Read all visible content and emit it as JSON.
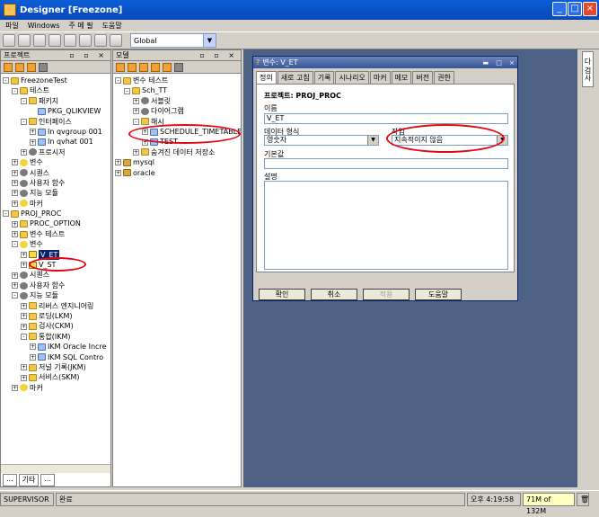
{
  "window": {
    "title": "Designer [Freezone]"
  },
  "menu": [
    "파일",
    "Windows",
    "주 메 필",
    "도움말"
  ],
  "toolbar": {
    "context_label": "Global"
  },
  "project_panel": {
    "title": "프로젝트",
    "tree": [
      {
        "d": 0,
        "label": "FreezoneTest",
        "icon": "folder",
        "exp": "-"
      },
      {
        "d": 1,
        "label": "테스트",
        "icon": "folder",
        "exp": "-"
      },
      {
        "d": 2,
        "label": "패키지",
        "icon": "folder",
        "exp": "-"
      },
      {
        "d": 3,
        "label": "PKG_QLIKVIEW",
        "icon": "doc",
        "exp": ""
      },
      {
        "d": 2,
        "label": "인터페이스",
        "icon": "folder",
        "exp": "-"
      },
      {
        "d": 3,
        "label": "In qvgroup 001",
        "icon": "doc",
        "exp": "+"
      },
      {
        "d": 3,
        "label": "In qvhat 001",
        "icon": "doc",
        "exp": "+"
      },
      {
        "d": 2,
        "label": "프로시저",
        "icon": "gear",
        "exp": "+"
      },
      {
        "d": 1,
        "label": "변수",
        "icon": "key",
        "exp": "+"
      },
      {
        "d": 1,
        "label": "시퀀스",
        "icon": "gear",
        "exp": "+"
      },
      {
        "d": 1,
        "label": "사용자 함수",
        "icon": "gear",
        "exp": "+"
      },
      {
        "d": 1,
        "label": "지능 모듈",
        "icon": "gear",
        "exp": "+"
      },
      {
        "d": 1,
        "label": "마커",
        "icon": "key",
        "exp": "+"
      },
      {
        "d": 0,
        "label": "PROJ_PROC",
        "icon": "folder",
        "exp": "-"
      },
      {
        "d": 1,
        "label": "PROC_OPTION",
        "icon": "folder",
        "exp": "+"
      },
      {
        "d": 1,
        "label": "변수 테스트",
        "icon": "folder",
        "exp": "+"
      },
      {
        "d": 1,
        "label": "변수",
        "icon": "key",
        "exp": "-"
      },
      {
        "d": 2,
        "label": "V_ET",
        "icon": "var",
        "exp": "+",
        "selected": true
      },
      {
        "d": 2,
        "label": "V_ST",
        "icon": "var",
        "exp": "+"
      },
      {
        "d": 1,
        "label": "시퀀스",
        "icon": "gear",
        "exp": "+"
      },
      {
        "d": 1,
        "label": "사용자 함수",
        "icon": "gear",
        "exp": "+"
      },
      {
        "d": 1,
        "label": "지능 모듈",
        "icon": "gear",
        "exp": "-"
      },
      {
        "d": 2,
        "label": "리버스 엔지니어링",
        "icon": "folder",
        "exp": "+"
      },
      {
        "d": 2,
        "label": "로딩(LKM)",
        "icon": "folder",
        "exp": "+"
      },
      {
        "d": 2,
        "label": "검사(CKM)",
        "icon": "folder",
        "exp": "+"
      },
      {
        "d": 2,
        "label": "통합(IKM)",
        "icon": "folder",
        "exp": "-"
      },
      {
        "d": 3,
        "label": "IKM Oracle Incre",
        "icon": "doc",
        "exp": "+"
      },
      {
        "d": 3,
        "label": "IKM SQL Contro",
        "icon": "doc",
        "exp": "+"
      },
      {
        "d": 2,
        "label": "저널 기록(JKM)",
        "icon": "folder",
        "exp": "+"
      },
      {
        "d": 2,
        "label": "서비스(SKM)",
        "icon": "folder",
        "exp": "+"
      },
      {
        "d": 1,
        "label": "마커",
        "icon": "key",
        "exp": "+"
      }
    ],
    "bottom_tabs": [
      "...",
      "기타",
      "..."
    ]
  },
  "model_panel": {
    "title": "모델",
    "tree": [
      {
        "d": 0,
        "label": "변수 테스트",
        "icon": "folder",
        "exp": "-"
      },
      {
        "d": 1,
        "label": "Sch_TT",
        "icon": "folder",
        "exp": "-"
      },
      {
        "d": 2,
        "label": "서블릿",
        "icon": "gear",
        "exp": "+"
      },
      {
        "d": 2,
        "label": "다이어그램",
        "icon": "gear",
        "exp": "+"
      },
      {
        "d": 2,
        "label": "해시",
        "icon": "folder",
        "exp": "-"
      },
      {
        "d": 3,
        "label": "SCHEDULE_TIMETABLE",
        "icon": "doc",
        "exp": "+"
      },
      {
        "d": 3,
        "label": "TEST",
        "icon": "doc",
        "exp": "+"
      },
      {
        "d": 2,
        "label": "숨겨진 데이터 저장소",
        "icon": "folder",
        "exp": "+"
      },
      {
        "d": 0,
        "label": "mysql",
        "icon": "db",
        "exp": "+"
      },
      {
        "d": 0,
        "label": "oracle",
        "icon": "db",
        "exp": "+"
      }
    ]
  },
  "dialog": {
    "title": "변수: V_ET",
    "tabs": [
      "정의",
      "새로 고침",
      "기록",
      "시나리오",
      "마커",
      "메모",
      "버전",
      "권한"
    ],
    "project_label": "프로젝트: PROJ_PROC",
    "name_label": "이름",
    "name_value": "V_ET",
    "datatype_label": "데이터 형식",
    "datatype_value": "영숫자",
    "action_label": "작업",
    "action_value": "지속적이지 않음",
    "default_label": "기본값",
    "default_value": "",
    "description_label": "설명",
    "description_value": "",
    "buttons": {
      "ok": "확인",
      "cancel": "취소",
      "apply": "적용",
      "help": "도움말"
    }
  },
  "right_tab": "다 검사",
  "status": {
    "user": "SUPERVISOR",
    "message": "완료",
    "time": "오후 4:19:58",
    "memory": "71M of 132M"
  },
  "colors": {
    "title_bar": "#0a5fd8",
    "desktop": "#4d6185",
    "highlight_oval": "#e30613",
    "selection": "#0a246a"
  }
}
